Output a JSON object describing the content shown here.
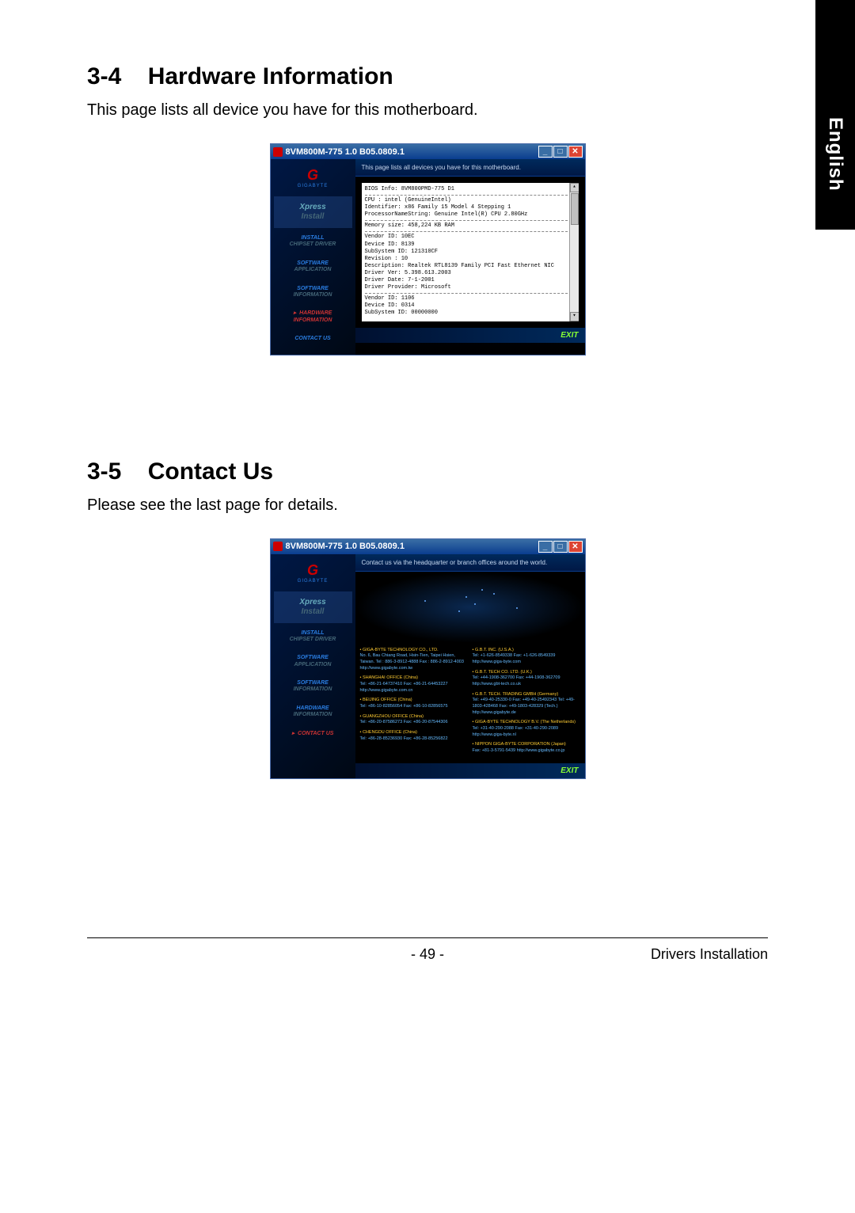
{
  "tab": {
    "label": "English"
  },
  "section1": {
    "number": "3-4",
    "title": "Hardware Information",
    "desc": "This page lists all device you have for this motherboard."
  },
  "section2": {
    "number": "3-5",
    "title": "Contact Us",
    "desc": "Please see the last page for details."
  },
  "window": {
    "title": "8VM800M-775 1.0 B05.0809.1",
    "logo_sub": "GIGABYTE"
  },
  "sidebar": {
    "item0": {
      "line1": "Xpress",
      "line2": "Install"
    },
    "item1": {
      "line1": "INSTALL",
      "line2": "CHIPSET DRIVER"
    },
    "item2": {
      "line1": "SOFTWARE",
      "line2": "APPLICATION"
    },
    "item3": {
      "line1": "SOFTWARE",
      "line2": "INFORMATION"
    },
    "item4": {
      "line1": "HARDWARE",
      "line2": "INFORMATION"
    },
    "item5": {
      "line1": "CONTACT US",
      "line2": ""
    }
  },
  "hw_banner": "This page lists all devices you have for this motherboard.",
  "hw": {
    "bios": "BIOS Info: 8VM800PMD-775 D1",
    "cpu1": "CPU : intel (GenuineIntel)",
    "cpu2": "Identifier: x86 Family 15 Model 4 Stepping 1",
    "cpu3": "ProcessorNameString: Genuine Intel(R) CPU 2.80GHz",
    "mem": "Memory size: 458,224  KB RAM",
    "v1a": "Vendor ID: 10EC",
    "v1b": "Device ID: 8139",
    "v1c": "SubSystem ID: 121310CF",
    "v1d": "Revision : 10",
    "v1e": "Description: Realtek RTL8139 Family PCI Fast Ethernet NIC",
    "v1f": "Driver Ver: 5.398.613.2003",
    "v1g": "Driver Date: 7-1-2001",
    "v1h": "Driver Provider: Microsoft",
    "v2a": "Vendor ID: 1106",
    "v2b": "Device ID: 0314",
    "v2c": "SubSystem ID: 00000000"
  },
  "contact_banner": "Contact us via the headquarter or branch offices around the world.",
  "contacts": {
    "c1": {
      "head": "• GIGA-BYTE TECHNOLOGY CO., LTD.",
      "body": "No. 6, Bau Chiang Road, Hsin-Tien,\nTaipei Hsien, Taiwan.\nTel : 886-3-8912-4888\nFax : 886-2-8912-4003\nhttp://www.gigabyte.com.tw"
    },
    "c2": {
      "head": "• SHANGHAI OFFICE (China)",
      "body": "Tel: +86-21-64737410  Fax: +86-21-64453227\nhttp://www.gigabyte.com.cn"
    },
    "c3": {
      "head": "• BEIJING OFFICE (China)",
      "body": "Tel: +86-10-82856054  Fax: +86-10-82856575"
    },
    "c4": {
      "head": "• GUANGZHOU OFFICE (China)",
      "body": "Tel: +86-20-87586273  Fax: +86-20-87544306"
    },
    "c5": {
      "head": "• CHENGDU OFFICE (China)",
      "body": "Tel: +86-28-85236930  Fax: +86-28-85256822"
    },
    "c6": {
      "head": "• G.B.T. INC. (U.S.A.)",
      "body": "Tel: +1-626-8549338  Fax: +1-626-8549339\nhttp://www.giga-byte.com"
    },
    "c7": {
      "head": "• G.B.T. TECH CO. LTD. (U.K.)",
      "body": "Tel: +44-1908-362700  Fax: +44-1908-362709\nhttp://www.gbt-tech.co.uk"
    },
    "c8": {
      "head": "• G.B.T. TECH. TRADING GMBH (Germany)",
      "body": "Tel: +49-40-25330-0  Fax: +49-40-25492343\nTel: +49-1803-428468 Fax: +49-1803-428329 (Tech.)\nhttp://www.gigabyte.de"
    },
    "c9": {
      "head": "• GIGA-BYTE TECHNOLOGY B.V. (The Netherlands)",
      "body": "Tel: +31-40-290-2088  Fax: +31-40-290-2089\nhttp://www.giga-byte.nl"
    },
    "c10": {
      "head": "• NIPPON GIGA-BYTE CORPORATION (Japan)",
      "body": "Fax: +81-3-5791-5439\nhttp://www.gigabyte.co.jp"
    }
  },
  "exit": "EXIT",
  "footer": {
    "page": "- 49 -",
    "label": "Drivers Installation"
  }
}
